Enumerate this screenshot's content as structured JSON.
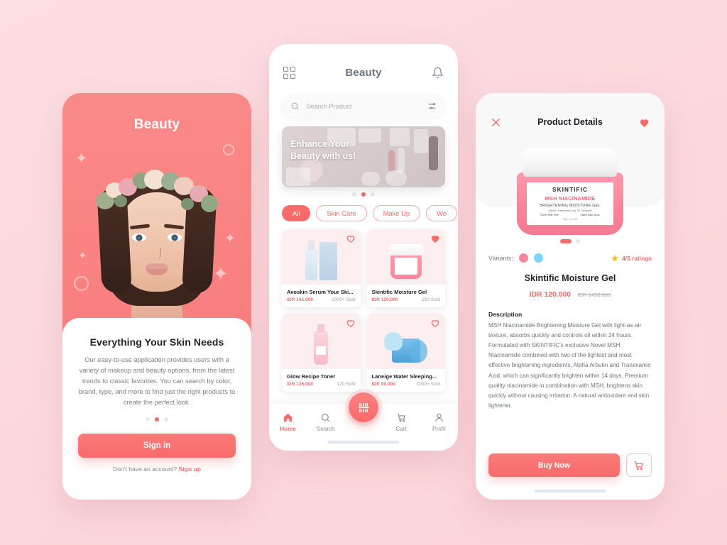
{
  "theme": {
    "accent": "#f96b6b",
    "accent_light": "#fba9a9",
    "background": "#fbdce0",
    "card_bg": "#ffffff",
    "text_dark": "#1f2126",
    "text_muted": "#7d8086",
    "star_gold": "#fcbf31",
    "swatch_pink": "#f9879c",
    "swatch_blue": "#7ed4f2"
  },
  "onboarding": {
    "brand": "Beauty",
    "headline": "Everything Your Skin Needs",
    "body": "Our easy-to-use application provides users with a variety of makeup and beauty options, from the latest trends to classic favorites. You can search by color, brand, type, and more to find just the right products to create the perfect look.",
    "dots": [
      {
        "active": false
      },
      {
        "active": true
      },
      {
        "active": false
      }
    ],
    "signin_label": "Sign in",
    "footer_prompt": "Don't have an account?",
    "signup_label": "Sign up"
  },
  "home": {
    "header": {
      "title": "Beauty",
      "grid_icon": "grid-icon",
      "bell_icon": "bell-icon"
    },
    "search": {
      "placeholder": "Search Product",
      "search_icon": "search-icon",
      "filter_icon": "filter-icon"
    },
    "banner": {
      "line1": "Enhance Your",
      "line2": "Beauty with us!",
      "dots": [
        {
          "active": false
        },
        {
          "active": true
        },
        {
          "active": false
        }
      ]
    },
    "categories": [
      {
        "label": "All",
        "active": true
      },
      {
        "label": "Skin Care",
        "active": false
      },
      {
        "label": "Make Up",
        "active": false
      },
      {
        "label": "Wo",
        "active": false
      }
    ],
    "products": [
      {
        "name": "Avoskin Serum Your Ski...",
        "price": "IDR 145.000",
        "sold": "1000+ Sold",
        "favorited": false,
        "art": "serum"
      },
      {
        "name": "Skintific Moisture Gel",
        "price": "IDR 120.000",
        "sold": "250 Sold",
        "favorited": true,
        "art": "jar"
      },
      {
        "name": "Glow Recipe Toner",
        "price": "IDR 135.000",
        "sold": "170 Sold",
        "favorited": false,
        "art": "bottle"
      },
      {
        "name": "Laneige Water Sleeping...",
        "price": "IDR 99.000",
        "sold": "1000+ Sold",
        "favorited": false,
        "art": "blue"
      }
    ],
    "tabs": [
      {
        "label": "Home",
        "icon": "home-icon",
        "active": true
      },
      {
        "label": "Search",
        "icon": "search-icon",
        "active": false
      },
      {
        "label": "Cart",
        "icon": "cart-icon",
        "active": false
      },
      {
        "label": "Profil",
        "icon": "person-icon",
        "active": false
      }
    ],
    "fab": {
      "icon": "barcode-scan-icon"
    }
  },
  "details": {
    "close_icon": "close-icon",
    "title": "Product Details",
    "favorite_icon": "heart-filled-icon",
    "product_art": {
      "brand": "SKINTIFIC",
      "variant": "MSH NIACINAMIDE",
      "subtitle": "BRIGHTENING MOISTURE GEL",
      "ingredients": "Arbutin, Tranexamic Acid, 5X Ceramide",
      "claim1": "Evens Skin Tone",
      "claim2": "Fades Dark Spots",
      "size": "30g / 1 FL.OZ"
    },
    "dots": [
      {
        "active": true
      },
      {
        "active": false
      }
    ],
    "variants_label": "Variants:",
    "variants": [
      {
        "color": "#f9879c",
        "selected": true
      },
      {
        "color": "#7ed4f2",
        "selected": false
      }
    ],
    "rating": "4/5 ratings",
    "star_icon": "star-icon",
    "name": "Skintific Moisture Gel",
    "price": "IDR 120.000",
    "old_price": "IDR 1490.000",
    "description_title": "Description",
    "description": "MSH Niacinamide Brightening Moisture Gel with light-as-air texture, absorbs quickly and controls oil within 24 hours. Formulated with SKINTIFIC's exclusive Novel MSH Niacinamide combined with two of the lightest and most effective brightening ingredients, Alpha Arbutin and Tranexamic Acid, which can significantly brighten within 14 days. Premium quality niacinamide in combination with MSH, brightens skin quickly without causing irritation. A natural antioxidant and skin lightener.",
    "buy_label": "Buy Now",
    "cart_icon": "cart-icon"
  }
}
